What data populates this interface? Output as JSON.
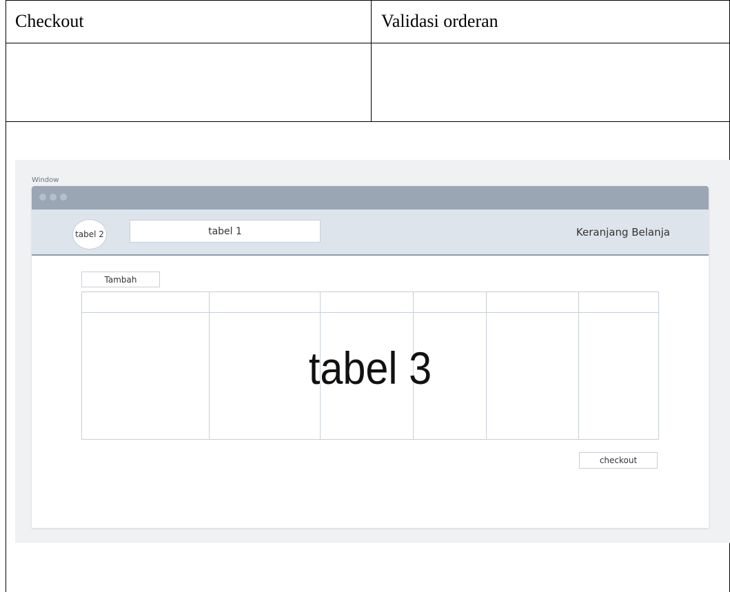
{
  "table": {
    "header_left": "Checkout",
    "header_right": "Validasi orderan"
  },
  "wireframe": {
    "window_label": "Window",
    "toolbar": {
      "circle_label": "tabel 2",
      "textbox_label": "tabel 1",
      "title": "Keranjang Belanja"
    },
    "add_button_label": "Tambah",
    "grid_label": "tabel 3",
    "checkout_button_label": "checkout"
  },
  "colors": {
    "titlebar": "#9aa6b3",
    "toolbar": "#dde4ec",
    "canvas": "#eff1f3",
    "border": "#c6ced8"
  }
}
